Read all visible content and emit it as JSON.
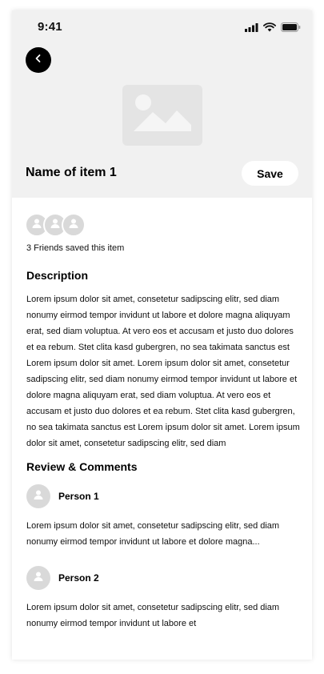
{
  "status_bar": {
    "time": "9:41",
    "icons": [
      "signal-icon",
      "wifi-icon",
      "battery-icon"
    ]
  },
  "header": {
    "back_icon": "chevron-left-icon",
    "image_icon": "image-placeholder-icon",
    "title": "Name of item 1",
    "save_label": "Save"
  },
  "friends": {
    "count": 3,
    "text": "3 Friends saved this item"
  },
  "description": {
    "heading": "Description",
    "text": "Lorem ipsum dolor sit amet, consetetur sadipscing elitr, sed diam nonumy eirmod tempor invidunt ut labore et dolore magna aliquyam erat, sed diam voluptua. At vero eos et accusam et justo duo dolores et ea rebum. Stet clita kasd gubergren, no sea takimata sanctus est Lorem ipsum dolor sit amet. Lorem ipsum dolor sit amet, consetetur sadipscing elitr, sed diam nonumy eirmod tempor invidunt ut labore et dolore magna aliquyam erat, sed diam voluptua. At vero eos et accusam et justo duo dolores et ea rebum. Stet clita kasd gubergren, no sea takimata sanctus est Lorem ipsum dolor sit amet. Lorem ipsum dolor sit amet, consetetur sadipscing elitr, sed diam"
  },
  "reviews": {
    "heading": "Review & Comments",
    "items": [
      {
        "name": "Person 1",
        "text": "Lorem ipsum dolor sit amet, consetetur sadipscing elitr, sed diam nonumy eirmod tempor invidunt ut labore et dolore magna..."
      },
      {
        "name": "Person 2",
        "text": "Lorem ipsum dolor sit amet, consetetur sadipscing elitr, sed diam nonumy eirmod tempor invidunt ut labore et"
      }
    ]
  },
  "colors": {
    "header_bg": "#f1f1f1",
    "placeholder": "#d9d9d9",
    "accent": "#000000"
  }
}
